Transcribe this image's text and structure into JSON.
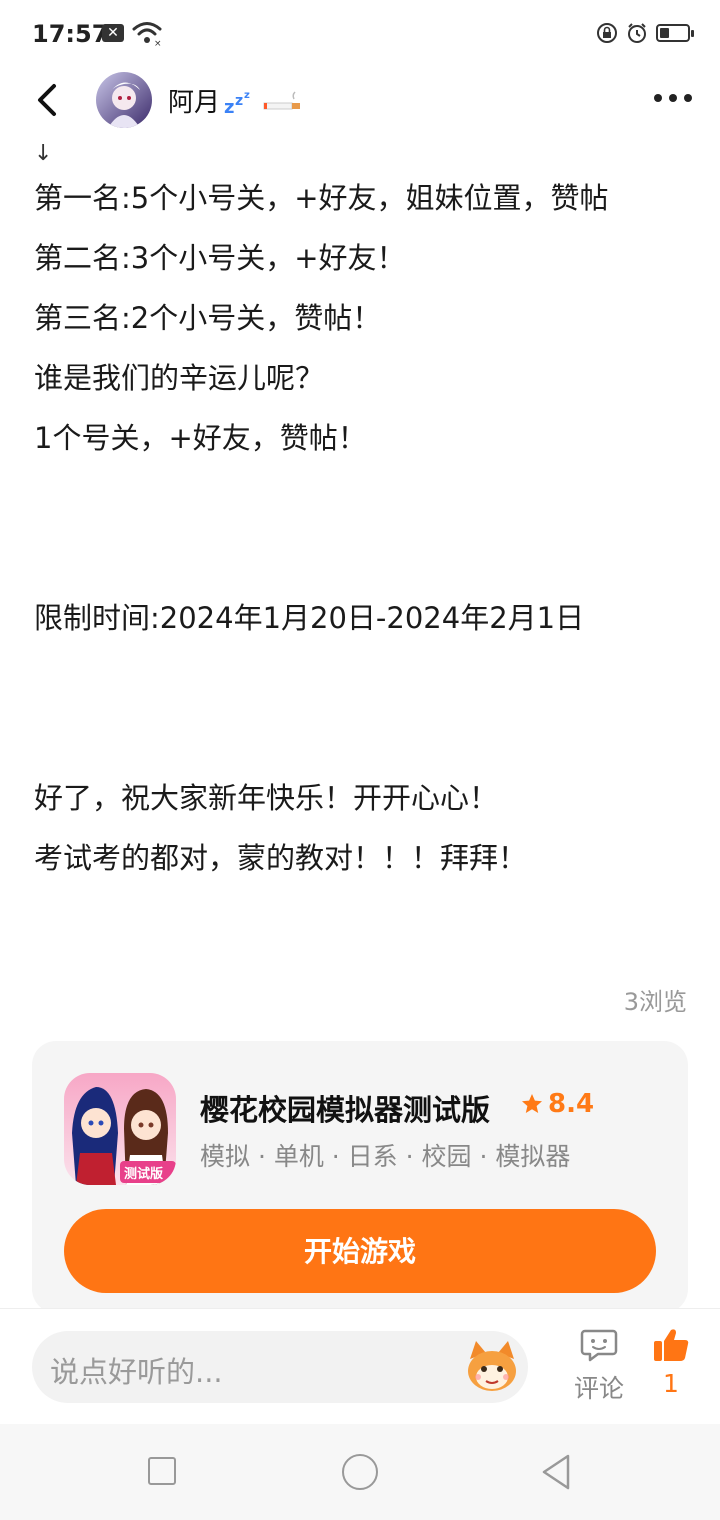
{
  "status_bar": {
    "time": "17:57",
    "notification_icon": "x-app-icon",
    "icons": [
      "wifi-icon",
      "lock-rotation-icon",
      "alarm-icon",
      "battery-icon"
    ],
    "battery_level": 0.35
  },
  "header": {
    "username": "阿月",
    "username_decorations": [
      "zzz-emoji",
      "cigarette-emoji"
    ]
  },
  "post": {
    "arrow": "↓",
    "lines": [
      "第一名:5个小号关，+好友，姐妹位置，赞帖",
      "第二名:3个小号关，+好友！",
      "第三名:2个小号关，赞帖！",
      "谁是我们的辛运儿呢？",
      "1个号关，+好友，赞帖！",
      "",
      "",
      "限制时间:2024年1月20日-2024年2月1日",
      "",
      "",
      "好了，祝大家新年快乐！开开心心！",
      "考试考的都对，蒙的教对！！！拜拜！"
    ],
    "views": "3浏览"
  },
  "game_card": {
    "title": "樱花校园模拟器测试版",
    "rating": "8.4",
    "tags": "模拟 · 单机 · 日系 · 校园 · 模拟器",
    "icon_badge": "测试版",
    "play_label": "开始游戏"
  },
  "bottom_bar": {
    "comment_placeholder": "说点好听的...",
    "comment_label": "评论",
    "like_count": "1"
  },
  "colors": {
    "accent": "#ff7514",
    "muted": "#999999",
    "card_bg": "#f5f5f5"
  }
}
